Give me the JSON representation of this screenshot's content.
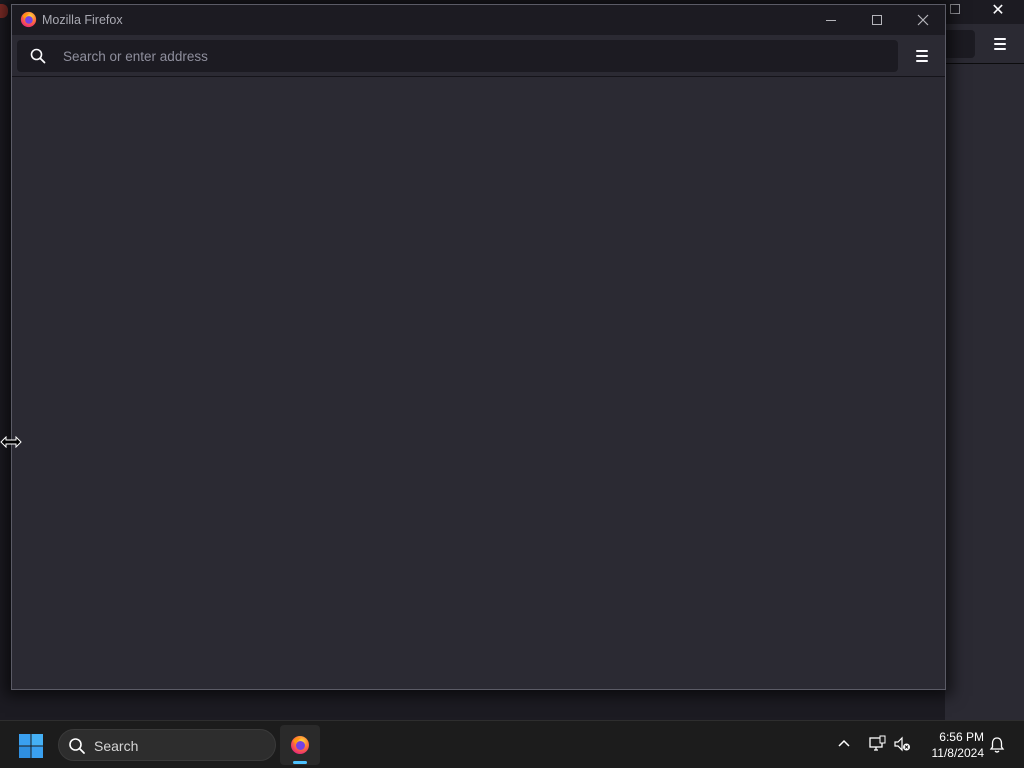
{
  "firefox_window": {
    "title": "Mozilla Firefox",
    "urlbar": {
      "placeholder": "Search or enter address",
      "value": ""
    },
    "window_controls": [
      "minimize",
      "maximize",
      "close"
    ]
  },
  "taskbar": {
    "search_label": "Search",
    "pinned_apps": [
      "firefox-icon"
    ],
    "clock": {
      "time": "6:56 PM",
      "date": "11/8/2024"
    }
  },
  "colors": {
    "titlebar": "#1c1b22",
    "toolbar": "#2b2a33",
    "urlbar": "#1c1b22",
    "taskbar": "#1c1c1c",
    "accent": "#4cc2ff"
  }
}
